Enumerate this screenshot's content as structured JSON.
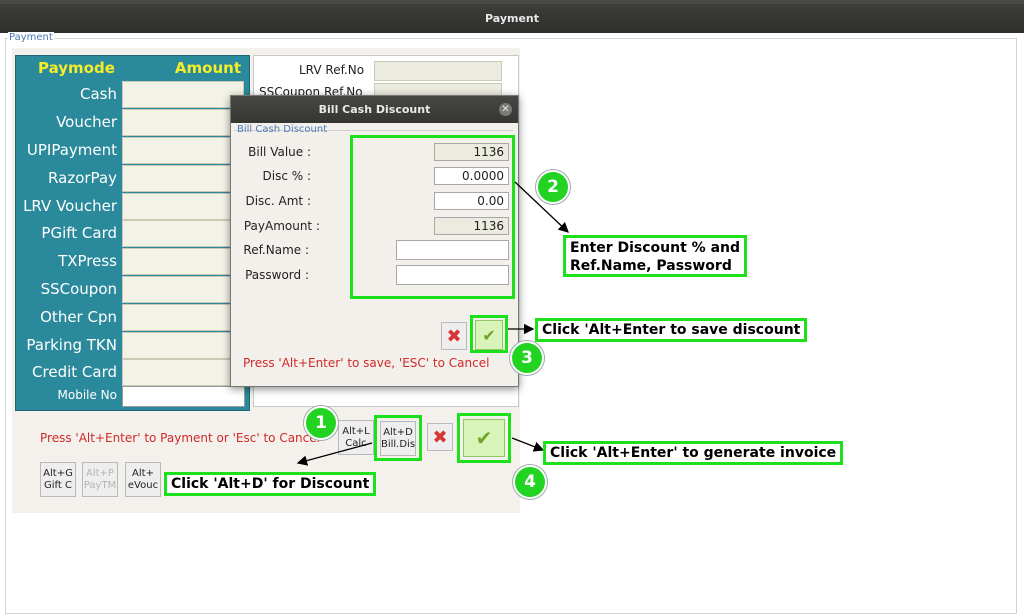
{
  "window": {
    "title": "Payment"
  },
  "group_title": "Payment",
  "paymode_table": {
    "header_paymode": "Paymode",
    "header_amount": "Amount",
    "rows": [
      {
        "label": "Cash"
      },
      {
        "label": "Voucher"
      },
      {
        "label": "UPIPayment"
      },
      {
        "label": "RazorPay"
      },
      {
        "label": "LRV Voucher"
      },
      {
        "label": "PGift Card"
      },
      {
        "label": "TXPress"
      },
      {
        "label": "SSCoupon"
      },
      {
        "label": "Other Cpn"
      },
      {
        "label": "Parking TKN"
      },
      {
        "label": "Credit Card"
      }
    ],
    "mobile_label": "Mobile No"
  },
  "ref_panel": {
    "lrv_ref_label": "LRV Ref.No",
    "sscoupon_ref_label": "SSCoupon Ref.No"
  },
  "bottom": {
    "hint": "Press 'Alt+Enter' to Payment or 'Esc' to Cancel",
    "calc_button": "Alt+L Calc",
    "bill_discount_button": "Alt+D Bill.Dis",
    "gift_button": "Alt+G Gift C",
    "paytm_button": "Alt+P PayTM",
    "evoucher_button": "Alt+ eVouc"
  },
  "dialog": {
    "title": "Bill Cash Discount",
    "close_icon": "close-icon",
    "group_title": "Bill Cash Discount",
    "fields": {
      "bill_value_label": "Bill Value :",
      "bill_value": "1136",
      "disc_pct_label": "Disc % :",
      "disc_pct": "0.0000",
      "disc_amt_label": "Disc. Amt :",
      "disc_amt": "0.00",
      "pay_amount_label": "PayAmount :",
      "pay_amount": "1136",
      "ref_name_label": "Ref.Name :",
      "ref_name": "",
      "password_label": "Password :",
      "password": ""
    },
    "hint": "Press 'Alt+Enter' to save, 'ESC' to Cancel"
  },
  "annotations": {
    "step1": "1",
    "step2": "2",
    "step3": "3",
    "step4": "4",
    "callout_discount": "Click 'Alt+D' for Discount",
    "callout_enter_line1": "Enter Discount % and",
    "callout_enter_line2": "Ref.Name, Password",
    "callout_save": "Click 'Alt+Enter to save discount",
    "callout_generate": "Click 'Alt+Enter' to generate invoice"
  },
  "colors": {
    "paymode_bg": "#2a8a9b",
    "paymode_header": "#f7ec2a",
    "highlight": "#1ce01c",
    "hint_red": "#d02a2a"
  }
}
